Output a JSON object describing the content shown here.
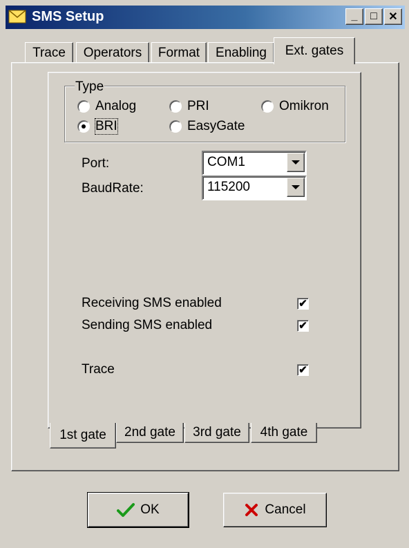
{
  "window": {
    "title": "SMS Setup"
  },
  "title_buttons": {
    "minimize": "_",
    "maximize": "□",
    "close": "✕"
  },
  "tabs": [
    "Trace",
    "Operators",
    "Format",
    "Enabling",
    "Ext. gates"
  ],
  "active_tab": "Ext. gates",
  "type_group": {
    "legend": "Type",
    "options": [
      "Analog",
      "PRI",
      "Omikron",
      "BRI",
      "EasyGate"
    ],
    "selected": "BRI"
  },
  "port": {
    "label": "Port:",
    "value": "COM1"
  },
  "baudrate": {
    "label": "BaudRate:",
    "value": "115200"
  },
  "checkboxes": [
    {
      "label": "Receiving SMS enabled",
      "checked": true
    },
    {
      "label": "Sending SMS enabled",
      "checked": true
    },
    {
      "label": "Trace",
      "checked": true
    }
  ],
  "check_mark": "✔",
  "gate_tabs": [
    "1st gate",
    "2nd gate",
    "3rd gate",
    "4th gate"
  ],
  "active_gate": "1st gate",
  "buttons": {
    "ok": "OK",
    "cancel": "Cancel"
  },
  "colors": {
    "title_bar": "#0a246a",
    "ok_icon": "#1a9a1a",
    "cancel_icon": "#cc0000",
    "face": "#d4d0c8"
  }
}
